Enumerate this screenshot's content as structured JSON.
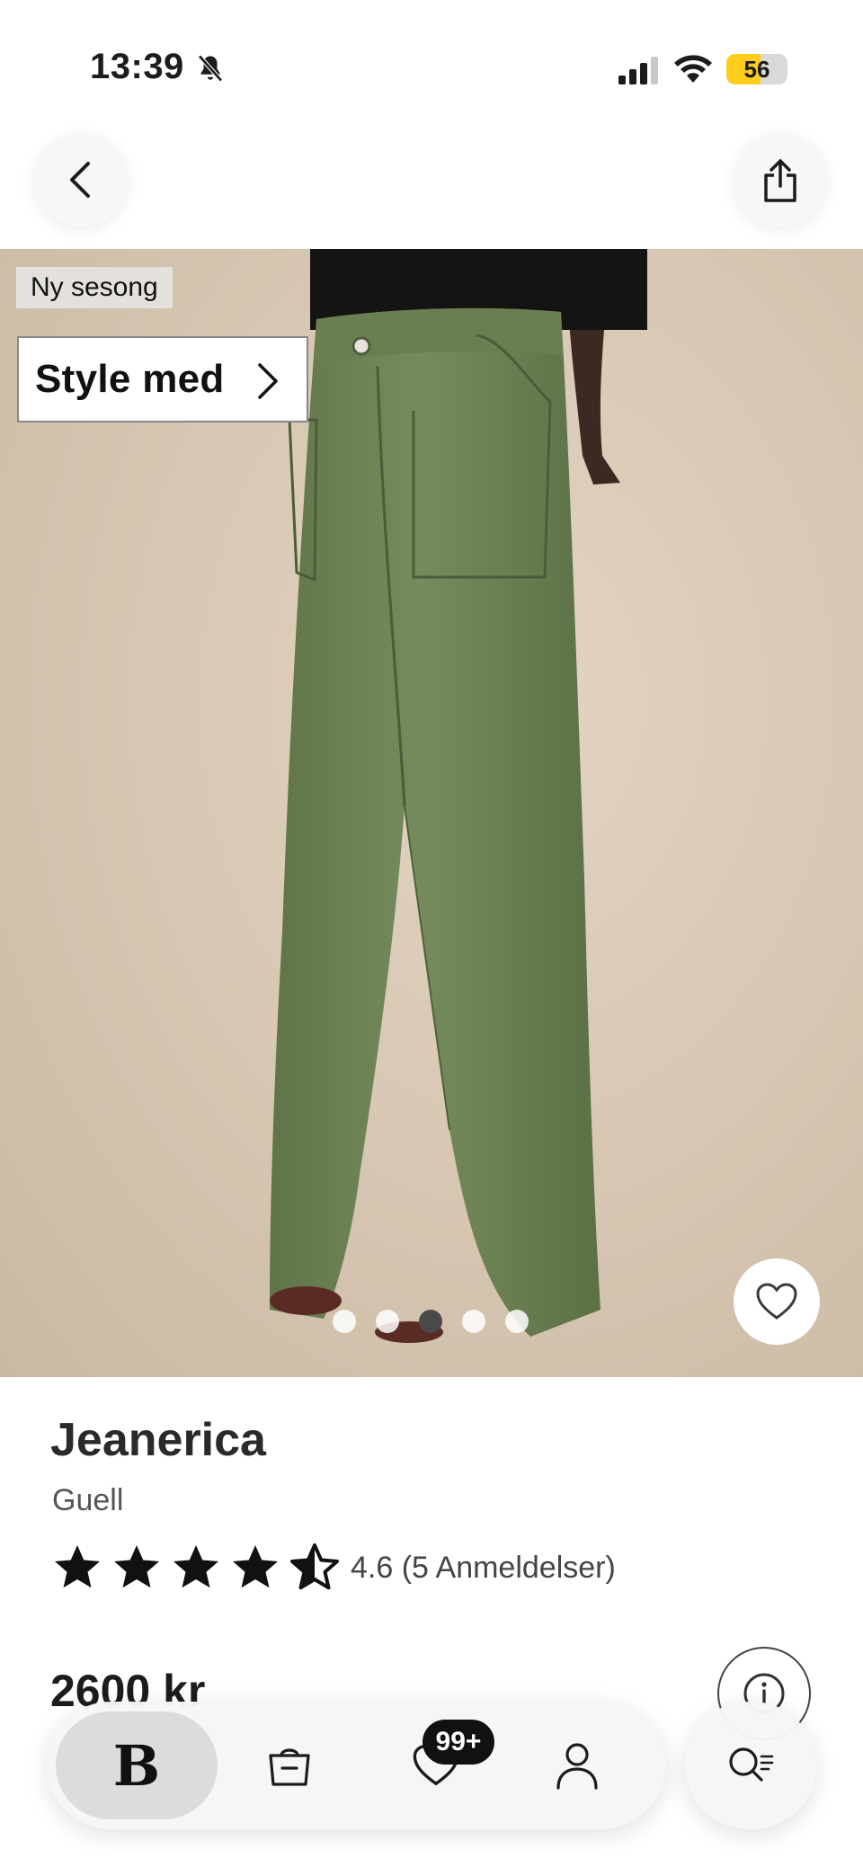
{
  "status_bar": {
    "time": "13:39",
    "battery_level": "56",
    "battery_fraction": 0.56,
    "icons": [
      "bell-slash-icon",
      "cellular-signal-icon",
      "wifi-icon",
      "battery-icon"
    ]
  },
  "nav": {
    "back_icon": "chevron-left-icon",
    "share_icon": "share-icon"
  },
  "product_image": {
    "badge": "Ny sesong",
    "style_button_label": "Style med",
    "carousel_total": 5,
    "carousel_active_index": 2,
    "favorite_icon": "heart-outline-icon"
  },
  "product": {
    "brand": "Jeanerica",
    "color": "Guell",
    "rating_value": 4.6,
    "rating_text": "4.6 (5 Anmeldelser)",
    "price": "2600 kr"
  },
  "tab_bar": {
    "home_label": "B",
    "favorites_count": "99+",
    "icons": [
      "bag-icon",
      "heart-icon",
      "person-icon",
      "search-list-icon"
    ]
  },
  "colors": {
    "accent_battery": "#ffcd1a",
    "background": "#ffffff",
    "pants_green": "#6f8457"
  }
}
